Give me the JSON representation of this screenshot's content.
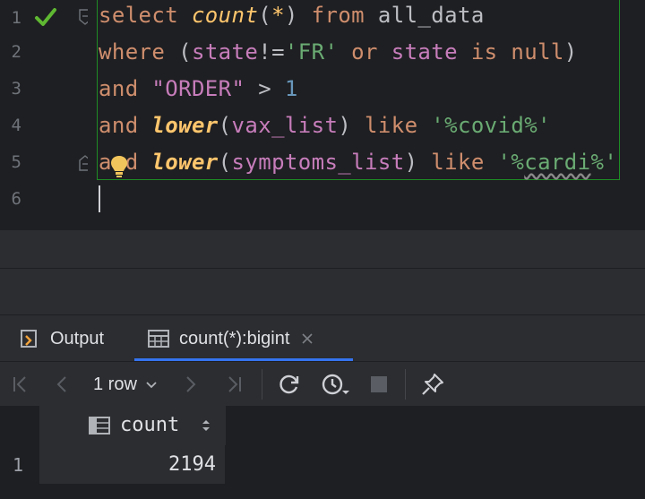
{
  "editor": {
    "line_numbers": [
      "1",
      "2",
      "3",
      "4",
      "5",
      "6"
    ],
    "lines": [
      [
        {
          "t": "select ",
          "c": "kw"
        },
        {
          "t": "count",
          "c": "fn"
        },
        {
          "t": "(",
          "c": "op"
        },
        {
          "t": "*",
          "c": "fn"
        },
        {
          "t": ") ",
          "c": "op"
        },
        {
          "t": "from ",
          "c": "kw"
        },
        {
          "t": "all_data",
          "c": "id"
        }
      ],
      [
        {
          "t": "where ",
          "c": "kw"
        },
        {
          "t": "(",
          "c": "op"
        },
        {
          "t": "state",
          "c": "col"
        },
        {
          "t": "!=",
          "c": "op"
        },
        {
          "t": "'FR'",
          "c": "str"
        },
        {
          "t": " or ",
          "c": "kw"
        },
        {
          "t": "state",
          "c": "col"
        },
        {
          "t": " is null",
          "c": "kw"
        },
        {
          "t": ")",
          "c": "op"
        }
      ],
      [
        {
          "t": "and ",
          "c": "kw"
        },
        {
          "t": "\"ORDER\"",
          "c": "col"
        },
        {
          "t": " > ",
          "c": "op"
        },
        {
          "t": "1",
          "c": "num"
        }
      ],
      [
        {
          "t": "and ",
          "c": "kw"
        },
        {
          "t": "lower",
          "c": "lfn"
        },
        {
          "t": "(",
          "c": "op"
        },
        {
          "t": "vax_list",
          "c": "col"
        },
        {
          "t": ") ",
          "c": "op"
        },
        {
          "t": "like ",
          "c": "kw"
        },
        {
          "t": "'%covid%'",
          "c": "str"
        }
      ],
      [
        {
          "t": "and ",
          "c": "kw"
        },
        {
          "t": "lower",
          "c": "lfn"
        },
        {
          "t": "(",
          "c": "op"
        },
        {
          "t": "symptoms_list",
          "c": "col"
        },
        {
          "t": ") ",
          "c": "op"
        },
        {
          "t": "like ",
          "c": "kw"
        },
        {
          "t": "'%",
          "c": "str"
        },
        {
          "t": "cardi",
          "c": "str squiggle"
        },
        {
          "t": "%'",
          "c": "str"
        }
      ],
      []
    ],
    "status_icon": "check-icon",
    "hint_icon": "lightbulb-icon"
  },
  "tabs": [
    {
      "label": "Output",
      "icon": "output-icon"
    },
    {
      "label": "count(*):bigint",
      "icon": "table-icon",
      "close_icon": "close-icon"
    }
  ],
  "toolbar": {
    "rows_label": "1 row",
    "icons": [
      "first-page-icon",
      "prev-page-icon",
      "next-page-icon",
      "last-page-icon",
      "reload-icon",
      "history-icon",
      "stop-icon",
      "pin-icon"
    ]
  },
  "grid": {
    "column": "count",
    "row_numbers": [
      "1"
    ],
    "rows": [
      [
        "2194"
      ]
    ]
  },
  "colors": {
    "keyword": "#cf8e6d",
    "function": "#ffc66d",
    "identifier": "#bcbec4",
    "column": "#c77dbb",
    "string": "#6aab73",
    "number": "#6897bb",
    "accent": "#3574f0",
    "check": "#5fb832",
    "bulb": "#f2c55c"
  }
}
